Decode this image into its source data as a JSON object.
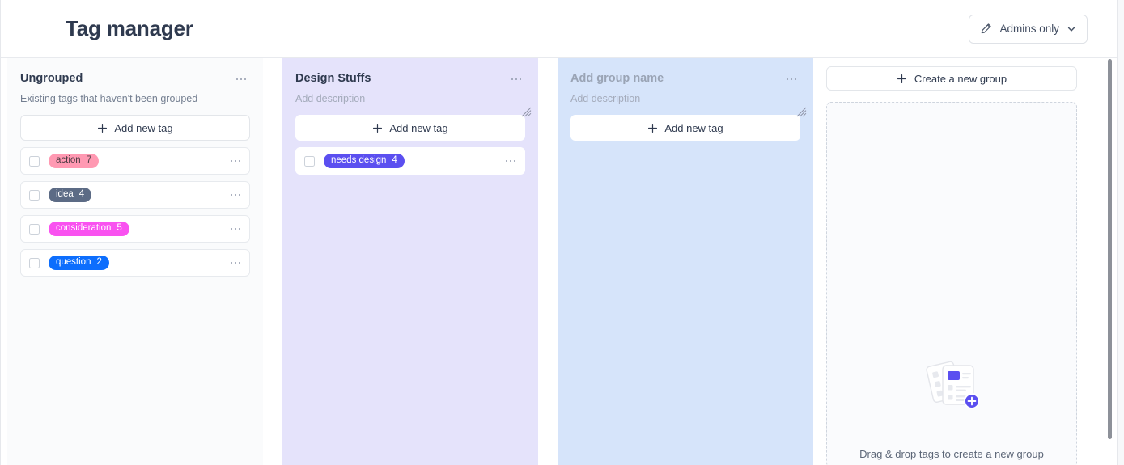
{
  "header": {
    "title": "Tag manager",
    "visibility": {
      "label": "Admins only",
      "edit_icon": "pencil-icon",
      "chevron_icon": "chevron-down-icon"
    }
  },
  "columns": [
    {
      "key": "ungrouped",
      "title": "Ungrouped",
      "title_is_placeholder": false,
      "description": "Existing tags that haven't been grouped",
      "description_is_placeholder": false,
      "bg": "#fafbfc",
      "has_resize_grip": false,
      "add_tag_label": "Add new tag",
      "menu_icon": "more-options-icon",
      "tags": [
        {
          "label": "action",
          "count": "7",
          "bg": "#ff99b2",
          "fg": "#4a3b42"
        },
        {
          "label": "idea",
          "count": "4",
          "bg": "#5c6b85",
          "fg": "#ffffff"
        },
        {
          "label": "consideration",
          "count": "5",
          "bg": "#f952f0",
          "fg": "#ffffff"
        },
        {
          "label": "question",
          "count": "2",
          "bg": "#0d6efd",
          "fg": "#ffffff"
        }
      ]
    },
    {
      "key": "design-stuffs",
      "title": "Design Stuffs",
      "title_is_placeholder": false,
      "description": "Add description",
      "description_is_placeholder": true,
      "bg": "#e5e3fb",
      "has_resize_grip": true,
      "add_tag_label": "Add new tag",
      "menu_icon": "more-options-icon",
      "tags": [
        {
          "label": "needs design",
          "count": "4",
          "bg": "#5b4ff0",
          "fg": "#ffffff"
        }
      ]
    },
    {
      "key": "new-group",
      "title": "Add group name",
      "title_is_placeholder": true,
      "description": "Add description",
      "description_is_placeholder": true,
      "bg": "#d6e4fa",
      "has_resize_grip": true,
      "add_tag_label": "Add new tag",
      "menu_icon": "more-options-icon",
      "tags": []
    }
  ],
  "right_panel": {
    "create_group_label": "Create a new group",
    "dropzone_caption": "Drag & drop tags to create a new group",
    "illustration_icon": "cards-stack-add-icon",
    "accent": "#5b4ff0"
  },
  "colors": {
    "page_bg": "#f7f8fa",
    "panel_bg": "#ffffff",
    "text_primary": "#2f3a4f",
    "text_muted": "#737e90",
    "border": "#e6e8ec"
  }
}
